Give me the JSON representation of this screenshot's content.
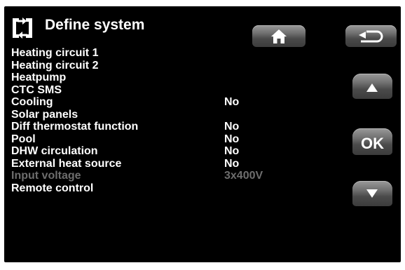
{
  "header": {
    "title": "Define system",
    "icon": "define-system-icon"
  },
  "menu": [
    {
      "label": "Heating circuit 1",
      "value": ""
    },
    {
      "label": "Heating circuit 2",
      "value": ""
    },
    {
      "label": "Heatpump",
      "value": ""
    },
    {
      "label": "CTC SMS",
      "value": ""
    },
    {
      "label": "Cooling",
      "value": "No"
    },
    {
      "label": "Solar panels",
      "value": ""
    },
    {
      "label": "Diff thermostat function",
      "value": "No"
    },
    {
      "label": "Pool",
      "value": "No"
    },
    {
      "label": "DHW circulation",
      "value": "No"
    },
    {
      "label": "External heat source",
      "value": "No"
    },
    {
      "label": "Input voltage",
      "value": "3x400V",
      "disabled": true
    },
    {
      "label": "Remote control",
      "value": ""
    }
  ],
  "buttons": {
    "home_icon": "home-icon",
    "back_icon": "back-arrow-icon",
    "up_icon": "triangle-up-icon",
    "ok_label": "OK",
    "down_icon": "triangle-down-icon"
  },
  "colors": {
    "background": "#000000",
    "text": "#ffffff",
    "disabled_text": "#6d6d6d",
    "button": "#5a5a5a"
  }
}
